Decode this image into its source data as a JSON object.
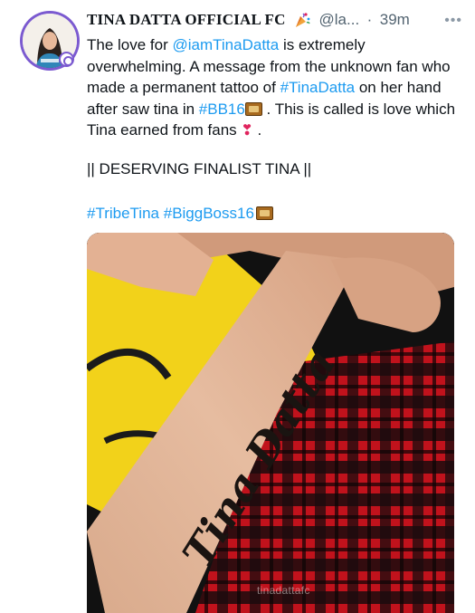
{
  "tweet": {
    "display_name": "TINA DATTA OFFICIAL FC",
    "handle": "@la...",
    "separator": "·",
    "time": "39m",
    "more_icon": "more-horizontal-icon",
    "text_parts": {
      "p1": "The love for ",
      "mention": "@iamTinaDatta",
      "p2": " is extremely overwhelming. A message from the unknown fan who made a permanent tattoo of ",
      "tag1": "#TinaDatta",
      "p3": " on her hand after saw tina in ",
      "tag2": "#BB16",
      "p4": " . This is called is love which Tina earned from fans ",
      "p5": " ."
    },
    "deserving": "|| DESERVING FINALIST TINA ||",
    "hashtags": [
      "#TribeTina",
      "#BiggBoss16"
    ],
    "colors": {
      "link": "#1d9bf0",
      "ring": "#7b5ad0",
      "text": "#0f1419",
      "muted": "#536471"
    }
  },
  "photo": {
    "tattoo_text": "Tina Datta",
    "watermark": "tinadattafc"
  }
}
